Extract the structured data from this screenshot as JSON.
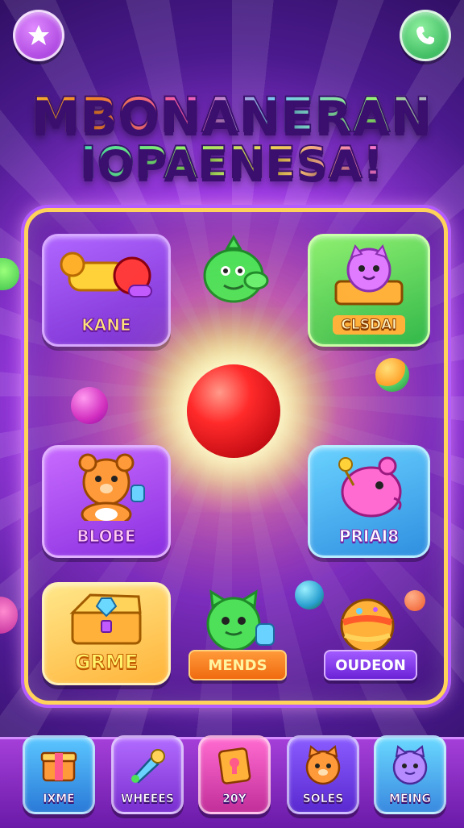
{
  "header": {
    "title_line1": "MBONANERAN",
    "title_line2": "IOPAENESA!",
    "left_button_icon": "star-icon",
    "right_button_icon": "phone-icon"
  },
  "board": {
    "tiles": [
      {
        "label": "KANE",
        "icon": "cannon-icon"
      },
      {
        "label": "CLSDAI",
        "icon": "cat-treasure-icon"
      },
      {
        "label": "BLOBE",
        "icon": "bear-icon"
      },
      {
        "label": "PRIAI8",
        "icon": "pink-creature-icon"
      },
      {
        "label": "GRME",
        "icon": "treasure-chest-icon"
      }
    ],
    "pills": [
      {
        "label": "MENDS",
        "icon": "green-cat-icon"
      },
      {
        "label": "OUDEON",
        "icon": "striped-ball-icon"
      }
    ],
    "center_icon": "red-ball-icon",
    "top_character_icon": "green-dragon-icon"
  },
  "nav": {
    "items": [
      {
        "label": "IXME",
        "icon": "box-icon"
      },
      {
        "label": "WHEEES",
        "icon": "rocket-icon"
      },
      {
        "label": "20Y",
        "icon": "book-icon"
      },
      {
        "label": "SOLES",
        "icon": "cat-face-icon"
      },
      {
        "label": "MEING",
        "icon": "blue-cat-icon"
      }
    ]
  },
  "colors": {
    "accent_gold": "#ffd25a",
    "board_border_purple": "#b35cff",
    "nav_bar": "#8a2fc8"
  }
}
